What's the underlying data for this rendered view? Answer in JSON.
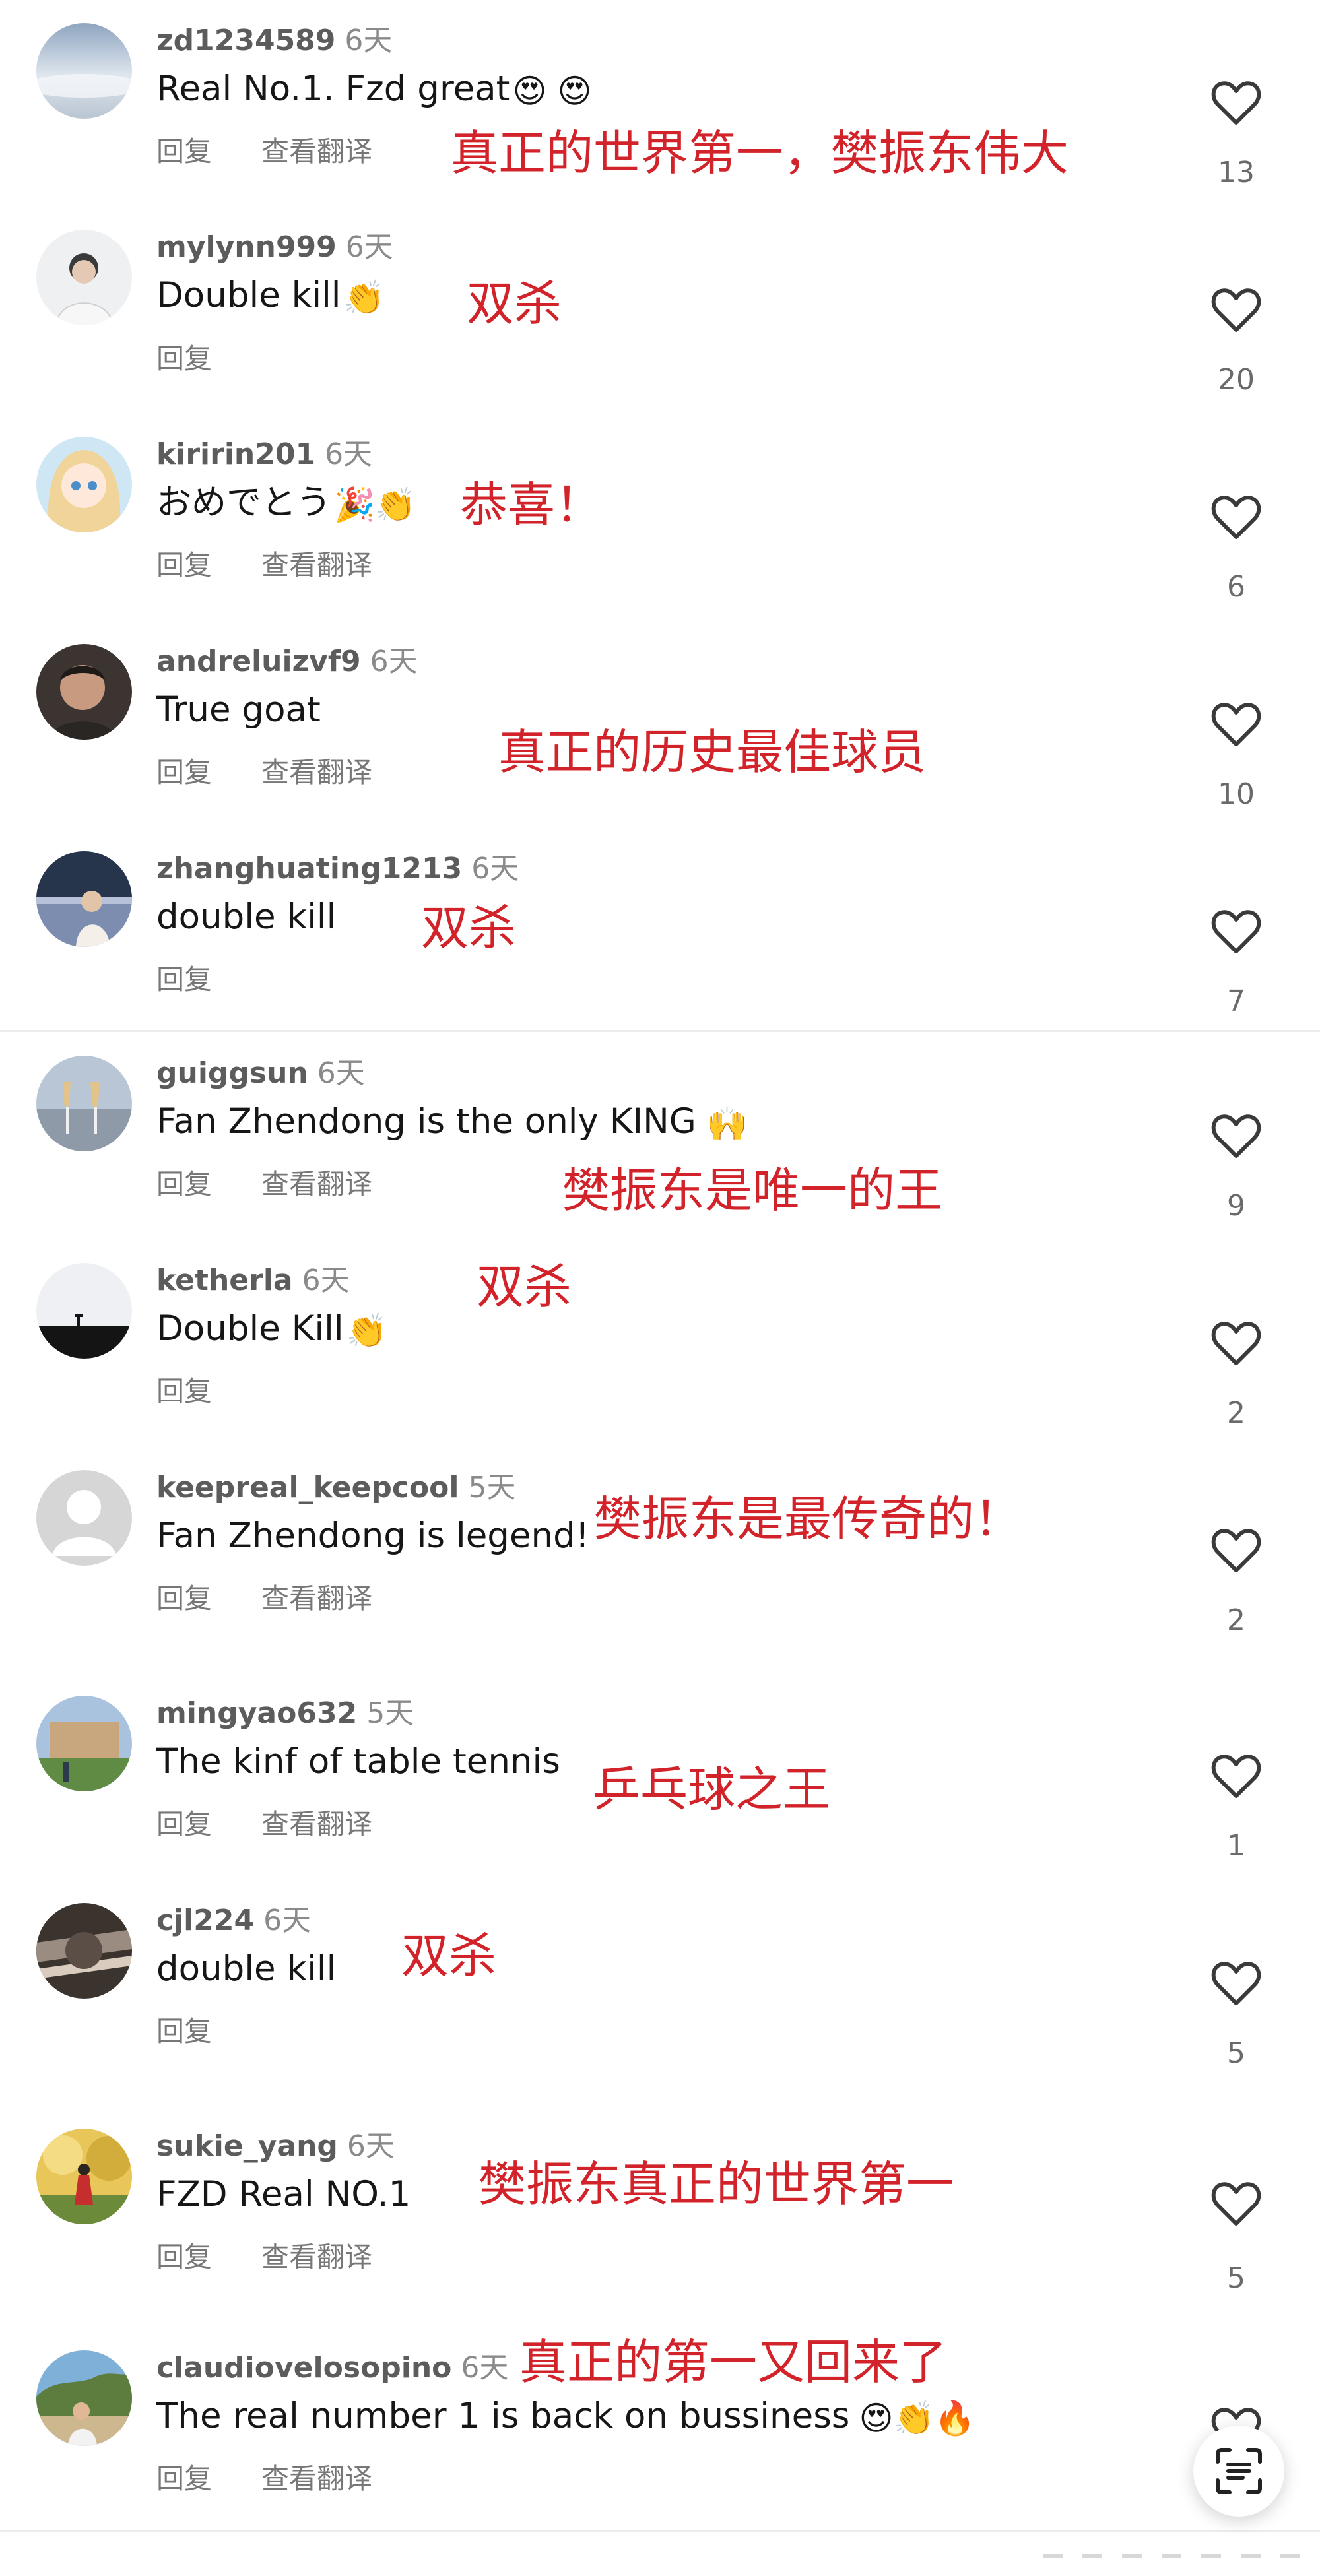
{
  "comments": [
    {
      "user": "zd1234589",
      "time": "6天",
      "text": "Real No.1.  Fzd great",
      "emojis": "😍 😍",
      "reply": "回复",
      "translate": "查看翻译",
      "annotation": "真正的世界第一，樊振东伟大",
      "likes": "13",
      "avatar_colors": [
        "#8ea5c0",
        "#dfe6ee"
      ]
    },
    {
      "user": "mylynn999",
      "time": "6天",
      "text": "Double kill",
      "emojis": "👏",
      "reply": "回复",
      "translate": "",
      "annotation": "双杀",
      "likes": "20",
      "avatar_colors": [
        "#d9dde2",
        "#f2f2f2"
      ]
    },
    {
      "user": "kiririn201",
      "time": "6天",
      "text": "おめでとう",
      "emojis": "🎉👏",
      "reply": "回复",
      "translate": "查看翻译",
      "annotation": "恭喜！",
      "likes": "6",
      "avatar_colors": [
        "#f1d49a",
        "#b6d8ef"
      ]
    },
    {
      "user": "andreluizvf9",
      "time": "6天",
      "text": "True goat",
      "emojis": "",
      "reply": "回复",
      "translate": "查看翻译",
      "annotation": "真正的历史最佳球员",
      "likes": "10",
      "avatar_colors": [
        "#4b3a33",
        "#c89a80"
      ]
    },
    {
      "user": "zhanghuating1213",
      "time": "6天",
      "text": "double kill",
      "emojis": "",
      "reply": "回复",
      "translate": "",
      "annotation": "双杀",
      "likes": "7",
      "avatar_colors": [
        "#26344c",
        "#7d8db0"
      ]
    },
    {
      "user": "guiggsun",
      "time": "6天",
      "text": "Fan Zhendong is the only KING",
      "emojis": "🙌",
      "reply": "回复",
      "translate": "查看翻译",
      "annotation": "樊振东是唯一的王",
      "likes": "9",
      "avatar_colors": [
        "#b8c6d6",
        "#e2c48a"
      ]
    },
    {
      "user": "ketherla",
      "time": "6天",
      "text": "Double Kill",
      "emojis": "👏",
      "reply": "回复",
      "translate": "",
      "annotation": "双杀",
      "likes": "2",
      "avatar_colors": [
        "#eef0f3",
        "#1a1a1a"
      ]
    },
    {
      "user": "keepreal_keepcool",
      "time": "5天",
      "text": "Fan Zhendong is legend!",
      "emojis": "",
      "reply": "回复",
      "translate": "查看翻译",
      "annotation": "樊振东是最传奇的！",
      "likes": "2",
      "avatar_colors": [
        "#d6d6d6",
        "#ffffff"
      ]
    },
    {
      "user": "mingyao632",
      "time": "5天",
      "text": "The kinf of table  tennis",
      "emojis": "",
      "reply": "回复",
      "translate": "查看翻译",
      "annotation": "乒乓球之王",
      "likes": "1",
      "avatar_colors": [
        "#a9c3de",
        "#5f8b45"
      ]
    },
    {
      "user": "cjl224",
      "time": "6天",
      "text": "double kill",
      "emojis": "",
      "reply": "回复",
      "translate": "",
      "annotation": "双杀",
      "likes": "5",
      "avatar_colors": [
        "#3a332e",
        "#9a8c80"
      ]
    },
    {
      "user": "sukie_yang",
      "time": "6天",
      "text": "FZD Real NO.1",
      "emojis": "",
      "reply": "回复",
      "translate": "查看翻译",
      "annotation": "樊振东真正的世界第一",
      "likes": "5",
      "avatar_colors": [
        "#e8c65a",
        "#6b8a3a"
      ]
    },
    {
      "user": "claudiovelosopino",
      "time": "6天",
      "text": "The real number 1 is back on bussiness",
      "emojis": "😍👏🔥",
      "reply": "回复",
      "translate": "查看翻译",
      "annotation": "真正的第一又回来了",
      "likes": "",
      "avatar_colors": [
        "#7fb0d8",
        "#5c7d3e"
      ]
    }
  ],
  "colors": {
    "annotation": "#d2232a",
    "username": "#5c5c5c",
    "muted": "#8a8a8a",
    "divider": "#ececec"
  },
  "icons": {
    "like": "heart-outline-icon",
    "scan": "scan-text-icon"
  }
}
